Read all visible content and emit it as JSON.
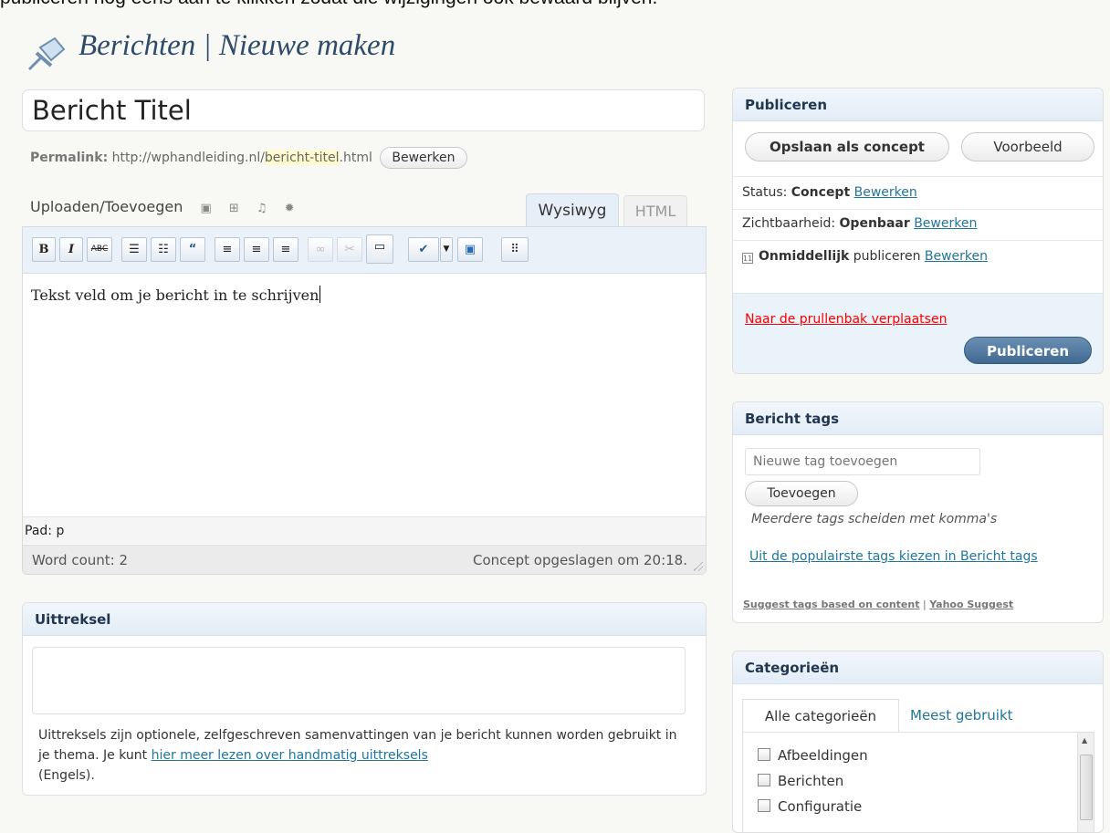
{
  "top_note": "publiceren nog eens aan te klikken zodat die wijzigingen ook bewaard blijven.",
  "page_title": "Berichten | Nieuwe maken",
  "post": {
    "title_value": "Bericht Titel",
    "permalink_label": "Permalink:",
    "permalink_base": "http://wphandleiding.nl/",
    "permalink_slug": "bericht-titel",
    "permalink_ext": ".html",
    "edit_button": "Bewerken"
  },
  "editor": {
    "upload_label": "Uploaden/Toevoegen",
    "media_icons": [
      "image-icon",
      "gallery-icon",
      "music-icon",
      "media-icon"
    ],
    "tab_visual": "Wysiwyg",
    "tab_html": "HTML",
    "toolbar": {
      "bold": "B",
      "italic": "I",
      "strike": "ABC",
      "align_icons": [
        "bullet-list",
        "numbered-list",
        "blockquote",
        "align-left",
        "align-center",
        "align-right",
        "link",
        "unlink",
        "more",
        "spellcheck",
        "fullscreen",
        "kitchen-sink"
      ]
    },
    "content": "Tekst veld om je bericht in te schrijven",
    "path": "Pad: p",
    "word_count": "Word count: 2",
    "saved_status": "Concept opgeslagen om 20:18."
  },
  "excerpt": {
    "title": "Uittreksel",
    "help_1": "Uittreksels zijn optionele, zelfgeschreven samenvattingen van je bericht kunnen worden gebruikt in je thema. Je kunt ",
    "help_link": "hier meer lezen over handmatig uittreksels",
    "help_2": "(Engels)."
  },
  "publish": {
    "title": "Publiceren",
    "save_draft": "Opslaan als concept",
    "preview": "Voorbeeld",
    "status_label": "Status:",
    "status_value": "Concept",
    "visibility_label": "Zichtbaarheid:",
    "visibility_value": "Openbaar",
    "schedule_value": "Onmiddellijk",
    "schedule_label": "publiceren",
    "edit": "Bewerken",
    "trash": "Naar de prullenbak verplaatsen",
    "publish_button": "Publiceren"
  },
  "tags": {
    "title": "Bericht tags",
    "placeholder": "Nieuwe tag toevoegen",
    "add_button": "Toevoegen",
    "help": "Meerdere tags scheiden met komma's",
    "popular_link": "Uit de populairste tags kiezen in Bericht tags",
    "suggest_content": "Suggest tags based on content",
    "suggest_sep": "|",
    "suggest_yahoo": "Yahoo Suggest"
  },
  "categories": {
    "title": "Categorieën",
    "tab_all": "Alle categorieën",
    "tab_most": "Meest gebruikt",
    "items": [
      "Afbeeldingen",
      "Berichten",
      "Configuratie"
    ]
  },
  "colors": {
    "link": "#21759b",
    "trash": "#ff0000",
    "publish_button": "#416a92",
    "box_header": "#e3edf7"
  }
}
